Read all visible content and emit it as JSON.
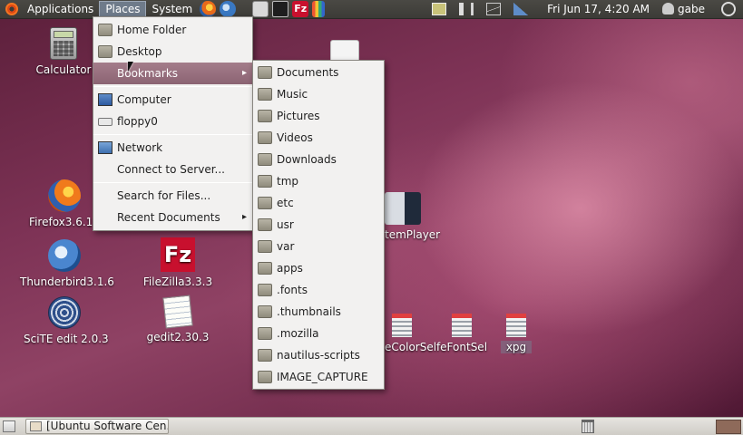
{
  "top_panel": {
    "menus": [
      "Applications",
      "Places",
      "System"
    ],
    "clock": "Fri Jun 17,  4:20 AM",
    "user": "gabe",
    "launchers": [
      "firefox-icon",
      "thunderbird-icon",
      "screenshot-icon",
      "terminal-icon",
      "filezilla-icon",
      "pencils-icon"
    ],
    "tray": [
      "display-icon",
      "volume-icon",
      "mail-icon",
      "signal-icon",
      "user-icon",
      "power-icon"
    ]
  },
  "places_menu": {
    "items": [
      {
        "label": "Home Folder",
        "icon": "home-folder-icon"
      },
      {
        "label": "Desktop",
        "icon": "desktop-folder-icon"
      },
      {
        "label": "Bookmarks",
        "icon": "bookmarks-icon",
        "submenu": true
      },
      {
        "label": "Computer",
        "icon": "computer-icon"
      },
      {
        "label": "floppy0",
        "icon": "floppy-icon"
      },
      {
        "label": "Network",
        "icon": "network-icon"
      },
      {
        "label": "Connect to Server...",
        "icon": ""
      },
      {
        "label": "Search for Files...",
        "icon": ""
      },
      {
        "label": "Recent Documents",
        "icon": "",
        "submenu": true
      }
    ]
  },
  "bookmarks_menu": {
    "items": [
      "Documents",
      "Music",
      "Pictures",
      "Videos",
      "Downloads",
      "tmp",
      "etc",
      "usr",
      "var",
      "apps",
      ".fonts",
      ".thumbnails",
      ".mozilla",
      "nautilus-scripts",
      "IMAGE_CAPTURE"
    ]
  },
  "desktop_icons": {
    "calculator": "Calculator",
    "firefox": "Firefox3.6.10",
    "thunderbird": "Thunderbird3.1.6",
    "filezilla": "FileZilla3.3.3",
    "scite": "SciTE edit 2.0.3",
    "gedit": "gedit2.30.3",
    "systemplayer": "temPlayer",
    "fecolorsel": "eColorSel",
    "fefontsel": "feFontSel",
    "xpg": "xpg"
  },
  "bottom_panel": {
    "task_label": "[Ubuntu Software Cen..."
  },
  "colors": {
    "panel": "#3c3b37",
    "highlight": "#8b6373",
    "menu_bg": "#f2f1f0"
  }
}
